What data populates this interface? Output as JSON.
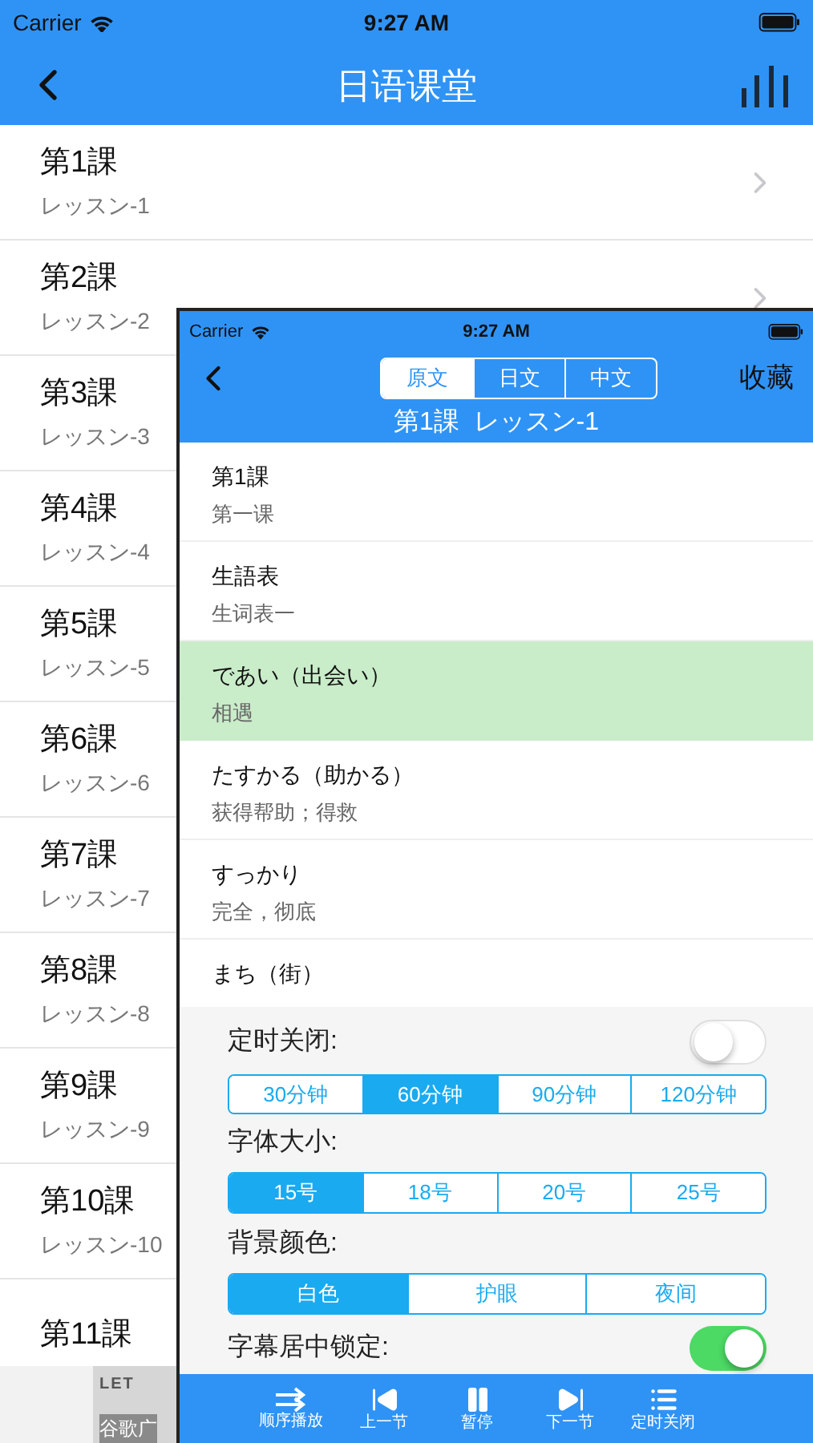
{
  "status_bar": {
    "carrier": "Carrier",
    "time": "9:27 AM"
  },
  "nav": {
    "title": "日语课堂"
  },
  "lessons": [
    {
      "title": "第1課",
      "subtitle": "レッスン-1",
      "chevron": true
    },
    {
      "title": "第2課",
      "subtitle": "レッスン-2",
      "chevron": true
    },
    {
      "title": "第3課",
      "subtitle": "レッスン-3"
    },
    {
      "title": "第4課",
      "subtitle": "レッスン-4"
    },
    {
      "title": "第5課",
      "subtitle": "レッスン-5"
    },
    {
      "title": "第6課",
      "subtitle": "レッスン-6"
    },
    {
      "title": "第7課",
      "subtitle": "レッスン-7"
    },
    {
      "title": "第8課",
      "subtitle": "レッスン-8"
    },
    {
      "title": "第9課",
      "subtitle": "レッスン-9"
    },
    {
      "title": "第10課",
      "subtitle": "レッスン-10"
    },
    {
      "title": "第11課"
    }
  ],
  "ad": {
    "line_1": "LET",
    "line_2": "谷歌广"
  },
  "player": {
    "status_bar": {
      "carrier": "Carrier",
      "time": "9:27 AM"
    },
    "tabs": [
      {
        "label": "原文",
        "selected": true
      },
      {
        "label": "日文",
        "selected": false
      },
      {
        "label": "中文",
        "selected": false
      }
    ],
    "action": "收藏",
    "subtitle": "第1課  レッスン-1",
    "items": [
      {
        "text": "第1課",
        "translation": "第一课",
        "selected": false
      },
      {
        "text": "生語表",
        "translation": "生词表一",
        "selected": false
      },
      {
        "text": "であい（出会い）",
        "translation": "相遇",
        "selected": true
      },
      {
        "text": "たすかる（助かる）",
        "translation": "获得帮助；得救",
        "selected": false
      },
      {
        "text": "すっかり",
        "translation": "完全，彻底",
        "selected": false
      },
      {
        "text": "まち（街）",
        "selected": false
      }
    ],
    "settings": {
      "timer": {
        "label": "定时关闭:",
        "on": false,
        "options": [
          {
            "label": "30分钟",
            "selected": false
          },
          {
            "label": "60分钟",
            "selected": true
          },
          {
            "label": "90分钟",
            "selected": false
          },
          {
            "label": "120分钟",
            "selected": false
          }
        ]
      },
      "font_size": {
        "label": "字体大小:",
        "options": [
          {
            "label": "15号",
            "selected": true
          },
          {
            "label": "18号",
            "selected": false
          },
          {
            "label": "20号",
            "selected": false
          },
          {
            "label": "25号",
            "selected": false
          }
        ]
      },
      "background": {
        "label": "背景颜色:",
        "options": [
          {
            "label": "白色",
            "selected": true
          },
          {
            "label": "护眼",
            "selected": false
          },
          {
            "label": "夜间",
            "selected": false
          }
        ]
      },
      "lock": {
        "label": "字幕居中锁定:",
        "on": true
      }
    },
    "toolbar": [
      {
        "kind": "order",
        "label": "顺序播放"
      },
      {
        "kind": "prev",
        "label": "上一节"
      },
      {
        "kind": "pause",
        "label": "暂停"
      },
      {
        "kind": "next",
        "label": "下一节"
      },
      {
        "kind": "list",
        "label": "定时关闭"
      }
    ]
  }
}
